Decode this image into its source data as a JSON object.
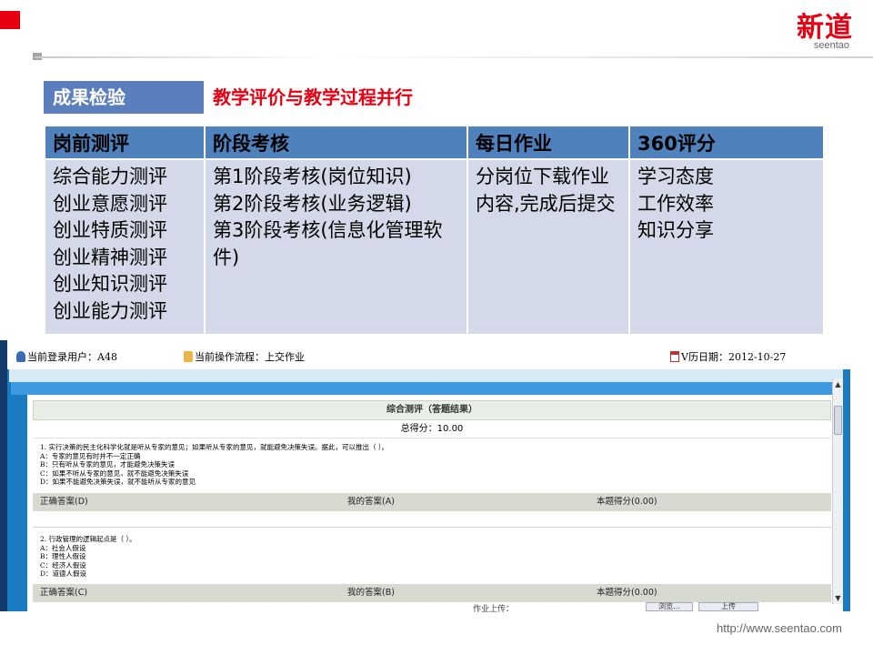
{
  "brand": {
    "name": "新道",
    "sub": "seentao"
  },
  "footer_url": "http://www.seentao.com",
  "section": {
    "label": "成果检验",
    "subtitle": "教学评价与教学过程并行"
  },
  "table": {
    "headers": [
      "岗前测评",
      "阶段考核",
      "每日作业",
      "360评分"
    ],
    "col1": [
      "综合能力测评",
      "创业意愿测评",
      "创业特质测评",
      "创业精神测评",
      "创业知识测评",
      "创业能力测评"
    ],
    "col2": [
      "第1阶段考核(岗位知识)",
      "第2阶段考核(业务逻辑)",
      "第3阶段考核(信息化管理软件)"
    ],
    "col3": "分岗位下载作业内容,完成后提交",
    "col4": [
      "学习态度",
      "工作效率",
      "知识分享"
    ]
  },
  "screenshot": {
    "user_label": "当前登录用户：A48",
    "process_label": "当前操作流程：上交作业",
    "date_label": "V历日期：2012-10-27",
    "result_title": "综合测评（答题结果）",
    "total_score": "总得分：10.00",
    "questions": [
      {
        "text": "1. 实行决策的民主化科学化就是听从专家的意见；如果听从专家的意见，就能避免决策失误。据此，可以推出（ ）。",
        "options": [
          "A：专家的意见有时并不一定正确",
          "B：只有听从专家的意见，才能避免决策失误",
          "C：如果不听从专家的意见，就不能避免决策失误",
          "D：如果不能避免决策失误，就不能听从专家的意见"
        ],
        "correct": "正确答案(D)",
        "mine": "我的答案(A)",
        "score": "本题得分(0.00)"
      },
      {
        "text": "2. 行政管理的逻辑起点是（ ）。",
        "options": [
          "A：社会人假设",
          "B：理性人假设",
          "C：经济人假设",
          "D：道德人假设"
        ],
        "correct": "正确答案(C)",
        "mine": "我的答案(B)",
        "score": "本题得分(0.00)"
      }
    ],
    "bottom_peek": "作业上传：",
    "bottom_btn1": "浏览...",
    "bottom_btn2": "上传"
  }
}
